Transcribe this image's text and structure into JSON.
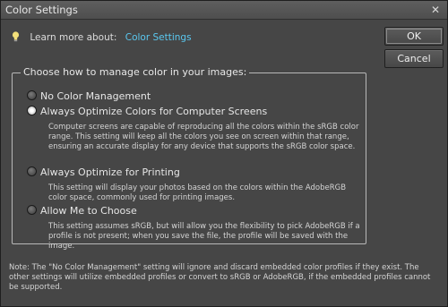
{
  "window": {
    "title": "Color Settings",
    "close_glyph": "✕"
  },
  "learn_more": {
    "label": "Learn more about:",
    "link": "Color Settings",
    "icon": "lightbulb-icon"
  },
  "buttons": {
    "ok": "OK",
    "cancel": "Cancel"
  },
  "group": {
    "legend": "Choose how to manage color in your images:",
    "options": [
      {
        "label": "No Color Management",
        "selected": false,
        "description": ""
      },
      {
        "label": "Always Optimize Colors for Computer Screens",
        "selected": true,
        "description": "Computer screens are capable of reproducing all the colors within the sRGB color range. This setting will keep all the colors you see on screen within that range, ensuring an accurate display for any device that supports the sRGB color space."
      },
      {
        "label": "Always Optimize for Printing",
        "selected": false,
        "description": "This setting will display your photos based on the colors within the AdobeRGB color space, commonly used for printing images."
      },
      {
        "label": "Allow Me to Choose",
        "selected": false,
        "description": "This setting assumes sRGB, but will allow you the flexibility to pick AdobeRGB if a profile is not present; when you save the file, the profile will be saved with the image."
      }
    ]
  },
  "note": "Note: The \"No Color Management\" setting will ignore and discard embedded color profiles if they exist. The other settings will utilize embedded profiles or convert to sRGB or AdobeRGB, if the embedded profiles cannot be supported.",
  "colors": {
    "link": "#5ac8f0",
    "background": "#464646",
    "text": "#e6e6e6"
  }
}
